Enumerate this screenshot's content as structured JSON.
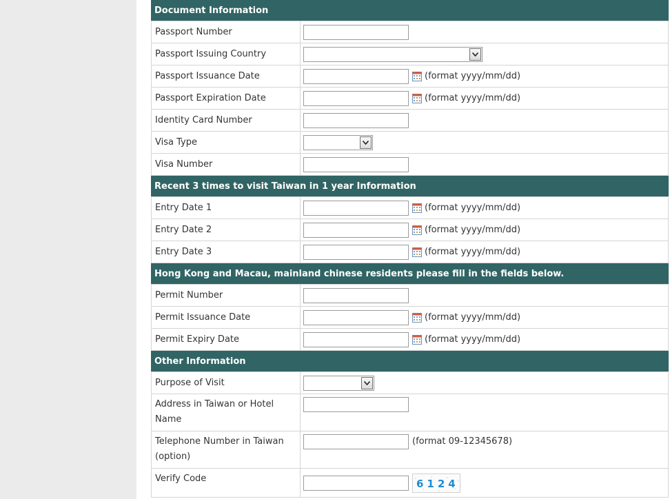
{
  "sections": {
    "document": "Document Information",
    "visits": "Recent 3 times to visit Taiwan in 1 year Information",
    "hkmacau": "Hong Kong and Macau, mainland chinese residents please fill in the fields below.",
    "other": "Other Information"
  },
  "labels": {
    "passport_number": "Passport Number",
    "passport_issuing_country": "Passport Issuing Country",
    "passport_issuance_date": "Passport Issuance Date",
    "passport_expiration_date": "Passport Expiration Date",
    "identity_card_number": "Identity Card Number",
    "visa_type": "Visa Type",
    "visa_number": "Visa Number",
    "entry_date_1": "Entry Date 1",
    "entry_date_2": "Entry Date 2",
    "entry_date_3": "Entry Date 3",
    "permit_number": "Permit Number",
    "permit_issuance_date": "Permit Issuance Date",
    "permit_expiry_date": "Permit Expiry Date",
    "purpose_of_visit": "Purpose of Visit",
    "address_in_taiwan": "Address in Taiwan or Hotel Name",
    "telephone_in_taiwan": "Telephone Number in Taiwan (option)",
    "verify_code": "Verify Code"
  },
  "hints": {
    "date_format": "(format yyyy/mm/dd)",
    "phone_format": "(format 09-12345678)"
  },
  "values": {
    "passport_number": "",
    "passport_issuing_country": "",
    "passport_issuance_date": "",
    "passport_expiration_date": "",
    "identity_card_number": "",
    "visa_type": "",
    "visa_number": "",
    "entry_date_1": "",
    "entry_date_2": "",
    "entry_date_3": "",
    "permit_number": "",
    "permit_issuance_date": "",
    "permit_expiry_date": "",
    "purpose_of_visit": "",
    "address_in_taiwan": "",
    "telephone_in_taiwan": "",
    "verify_code": ""
  },
  "captcha": {
    "code": "6124"
  },
  "icons": {
    "calendar": "calendar-icon",
    "dropdown": "chevron-down-icon"
  },
  "colors": {
    "section_header_bg": "#316464",
    "section_header_text": "#ffffff",
    "sidebar_bg": "#ebebeb",
    "captcha_text": "#1f8bd2"
  }
}
